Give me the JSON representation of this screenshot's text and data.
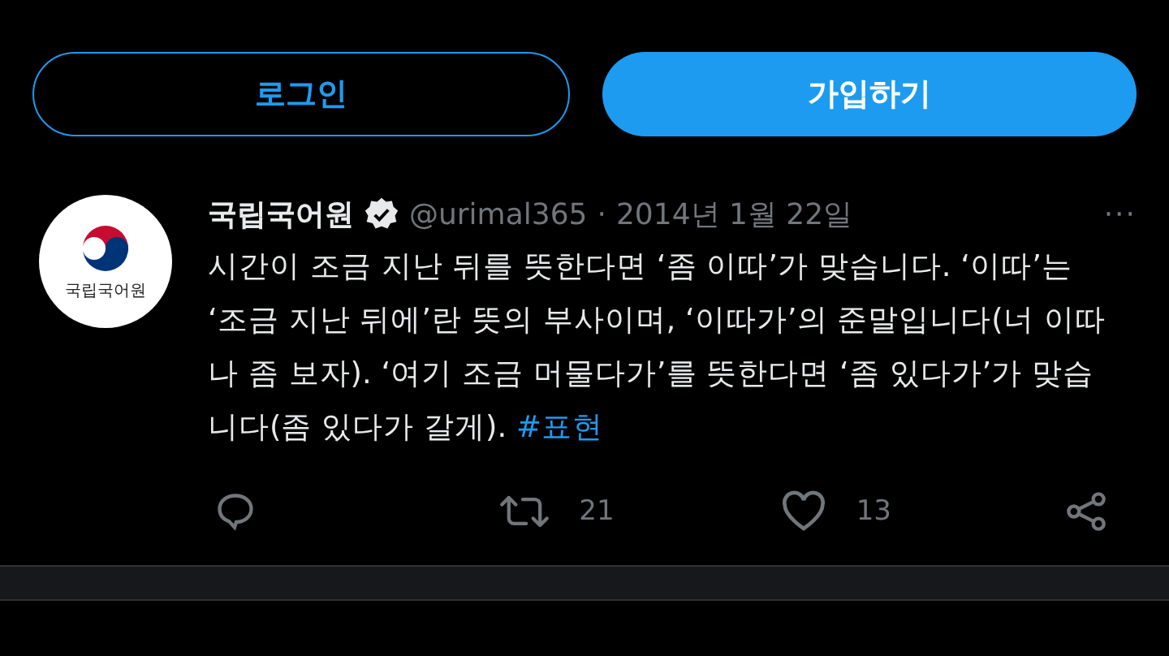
{
  "buttons": [
    {
      "label": "로그인",
      "kind": "outline"
    },
    {
      "label": "가입하기",
      "kind": "filled"
    }
  ],
  "tweet": {
    "avatar_label": "국립국어원",
    "name": "국립국어원",
    "verified": true,
    "handle": "@urimal365",
    "separator": "·",
    "date": "2014년 1월 22일",
    "more": "···",
    "text": "시간이 조금 지난 뒤를 뜻한다면 ‘좀 이따’가 맞습니다. ‘이따’는 ‘조금 지난 뒤에’란 뜻의 부사이며, ‘이따가’의 준말입니다(너 이따 나 좀 보자).  ‘여기 조금 머물다가’를 뜻한다면 ‘좀 있다가’가 맞습니다(좀 있다가 갈게).",
    "hashtag": "#표현",
    "actions": [
      {
        "kind": "reply"
      },
      {
        "kind": "retweet",
        "count": "21"
      },
      {
        "kind": "like",
        "count": "13"
      },
      {
        "kind": "share"
      }
    ]
  }
}
